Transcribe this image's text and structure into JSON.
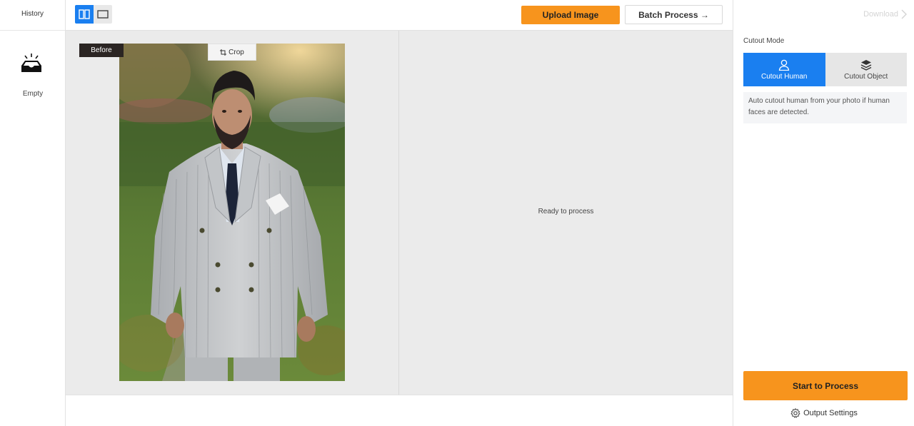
{
  "history": {
    "title": "History",
    "empty_label": "Empty",
    "empty_icon": "empty-inbox-icon"
  },
  "toolbar": {
    "view_modes": [
      {
        "icon": "split-view-icon",
        "active": true
      },
      {
        "icon": "single-view-icon",
        "active": false
      }
    ],
    "upload_label": "Upload Image",
    "batch_label": "Batch Process →"
  },
  "workspace": {
    "before_label": "Before",
    "crop_label": "Crop",
    "crop_icon": "crop-icon",
    "status_text": "Ready to process"
  },
  "panel": {
    "download_label": "Download",
    "download_icon": "chevron-right-icon",
    "mode_label": "Cutout Mode",
    "modes": [
      {
        "label": "Cutout Human",
        "icon": "person-icon",
        "active": true
      },
      {
        "label": "Cutout Object",
        "icon": "layers-icon",
        "active": false
      }
    ],
    "mode_description": "Auto cutout human from your photo if human faces are detected.",
    "start_label": "Start to Process",
    "output_settings_label": "Output Settings",
    "output_settings_icon": "gear-icon"
  },
  "colors": {
    "accent_blue": "#1a7ff0",
    "accent_orange": "#f7941d",
    "workspace_bg": "#ebebeb"
  }
}
